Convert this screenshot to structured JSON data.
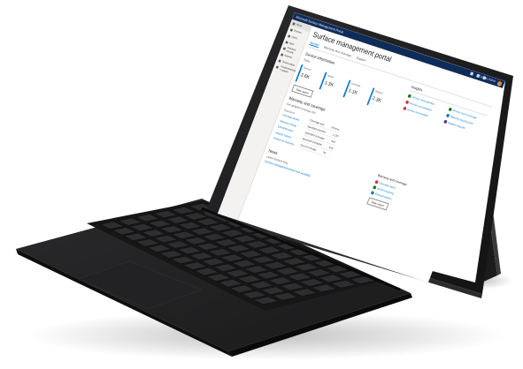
{
  "window": {
    "title": "Microsoft Surface Management Portal",
    "user_name": "Contoso Admin"
  },
  "nav": {
    "items": [
      {
        "label": "Home"
      },
      {
        "label": "Devices"
      },
      {
        "label": "Users"
      },
      {
        "label": "Apps"
      },
      {
        "label": "Endpoint security"
      },
      {
        "label": "Reports"
      },
      {
        "label": "Tenant admin"
      },
      {
        "label": "Troubleshooting + support"
      }
    ]
  },
  "page": {
    "title": "Surface management portal",
    "tabs": [
      {
        "label": "Monitor"
      },
      {
        "label": "Warranty and coverage"
      },
      {
        "label": "Support"
      }
    ],
    "device_info": {
      "title": "Device information",
      "sub": "Totals",
      "cards": [
        {
          "label": "Devices",
          "value": "2.6K"
        },
        {
          "label": "Health",
          "value": "1.3K"
        },
        {
          "label": "Coverage",
          "value": "1.1K"
        },
        {
          "label": "Support",
          "value": "2.3K"
        }
      ],
      "button": "View report"
    },
    "insights": {
      "title": "Insights",
      "items": [
        {
          "label": "Devices need attention",
          "color": "#107c10"
        },
        {
          "label": "Devices out of coverage",
          "color": "#107c10"
        },
        {
          "label": "Devices not compliant",
          "color": "#d13438"
        },
        {
          "label": "Warranty expiring soon",
          "color": "#0078d4"
        },
        {
          "label": "Devices not enrolled",
          "color": "#d13438"
        },
        {
          "label": "Support requests",
          "color": "#5c2e91"
        }
      ]
    },
    "coverage": {
      "title": "Warranty and coverage",
      "sub": "Get updated coverage info",
      "col1_header": "Resources",
      "col1": [
        "Coverage details",
        "Warranty lookup",
        "Extended plans",
        "Support options",
        "Surface for Business"
      ],
      "table_header": [
        "Coverage type",
        "Devices"
      ],
      "rows": [
        [
          "Standard warranty",
          "1,120"
        ],
        [
          "Extended coverage",
          "642"
        ],
        [
          "Microsoft Complete",
          "318"
        ],
        [
          "Out of coverage",
          "96"
        ]
      ]
    },
    "right_card": {
      "title": "Warranty and coverage",
      "items": [
        {
          "label": "Coverage report",
          "color": "#d13438"
        },
        {
          "label": "Devices expiring",
          "color": "#107c10"
        },
        {
          "label": "Renewal options",
          "color": "#0078d4"
        }
      ],
      "button": "View report"
    },
    "news": {
      "title": "News",
      "sub": "Latest Surface blog",
      "link": "Surface management portal now available"
    }
  }
}
